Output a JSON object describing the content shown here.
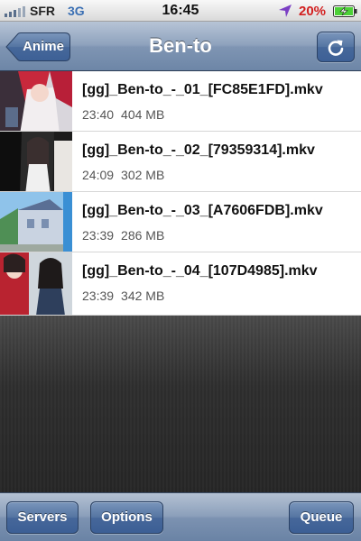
{
  "status_bar": {
    "carrier": "SFR",
    "network": "3G",
    "time": "16:45",
    "battery_percent": "20%",
    "icons": [
      "signal-bars-icon",
      "location-arrow-icon",
      "battery-charging-icon"
    ]
  },
  "nav": {
    "back_label": "Anime",
    "title": "Ben-to",
    "refresh_icon": "refresh-icon"
  },
  "episodes": [
    {
      "file_name": "[gg]_Ben-to_-_01_[FC85E1FD].mkv",
      "duration": "23:40",
      "size": "404 MB"
    },
    {
      "file_name": "[gg]_Ben-to_-_02_[79359314].mkv",
      "duration": "24:09",
      "size": "302 MB"
    },
    {
      "file_name": "[gg]_Ben-to_-_03_[A7606FDB].mkv",
      "duration": "23:39",
      "size": "286 MB"
    },
    {
      "file_name": "[gg]_Ben-to_-_04_[107D4985].mkv",
      "duration": "23:39",
      "size": "342 MB"
    }
  ],
  "toolbar": {
    "servers_label": "Servers",
    "options_label": "Options",
    "queue_label": "Queue"
  },
  "colors": {
    "nav_bar": "#8ea2bd",
    "battery_low": "#d21f1f",
    "network_text": "#3a6fb3",
    "battery_charge": "#4cd137"
  }
}
